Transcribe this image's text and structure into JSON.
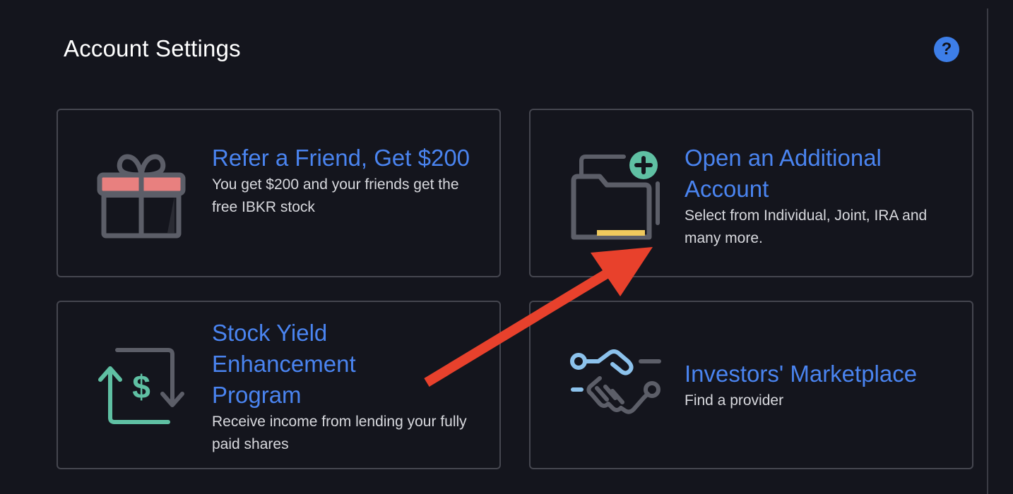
{
  "page": {
    "title": "Account Settings",
    "help_label": "?"
  },
  "cards": [
    {
      "title": "Refer a Friend, Get $200",
      "description": "You get $200 and your friends get the free IBKR stock",
      "icon": "gift-icon"
    },
    {
      "title": "Open an Additional Account",
      "description": "Select from Individual, Joint, IRA and many more.",
      "icon": "folder-add-icon"
    },
    {
      "title": "Stock Yield Enhancement Program",
      "description": "Receive income from lending your fully paid shares",
      "icon": "dollar-exchange-icon"
    },
    {
      "title": "Investors' Marketplace",
      "description": "Find a provider",
      "icon": "handshake-icon"
    }
  ],
  "colors": {
    "background": "#14151d",
    "accent": "#4a84f0",
    "card_border": "#45464f",
    "annotation_arrow": "#e8412c"
  }
}
